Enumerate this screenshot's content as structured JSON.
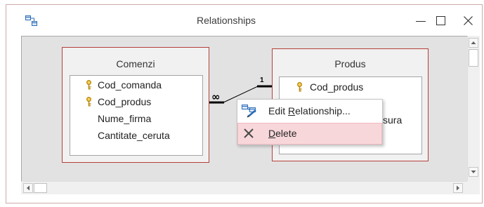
{
  "window": {
    "title": "Relationships"
  },
  "icons": {
    "app": "relationships-icon",
    "minimize": "minimize-icon",
    "maximize": "maximize-icon",
    "close": "close-icon",
    "primary_key": "primary-key-icon",
    "scroll_up": "scroll-up-arrow-icon",
    "scroll_down": "scroll-down-arrow-icon",
    "scroll_left": "scroll-left-arrow-icon",
    "scroll_right": "scroll-right-arrow-icon"
  },
  "tables": [
    {
      "name": "Comenzi",
      "fields": [
        {
          "name": "Cod_comanda",
          "key": true
        },
        {
          "name": "Cod_produs",
          "key": true
        },
        {
          "name": "Nume_firma",
          "key": false
        },
        {
          "name": "Cantitate_ceruta",
          "key": false
        }
      ]
    },
    {
      "name": "Produs",
      "fields": [
        {
          "name": "Cod_produs",
          "key": true
        },
        {
          "name": "sura",
          "key": false
        }
      ]
    }
  ],
  "relationship": {
    "many_side_symbol": "∞",
    "one_side_symbol": "1"
  },
  "context_menu": {
    "items": [
      {
        "label_before": "Edit ",
        "accelerator": "R",
        "label_after": "elationship...",
        "icon": "edit-relationship-icon",
        "highlighted": false
      },
      {
        "label_before": "",
        "accelerator": "D",
        "label_after": "elete",
        "icon": "delete-icon",
        "highlighted": true
      }
    ]
  },
  "colors": {
    "table_border": "#b5403a",
    "canvas_background": "#e2e2e2",
    "menu_highlight": "#f8d7da",
    "key_icon": "#e6b422",
    "relationship_icon": "#2b6cb8",
    "relationship_line": "#000000"
  }
}
